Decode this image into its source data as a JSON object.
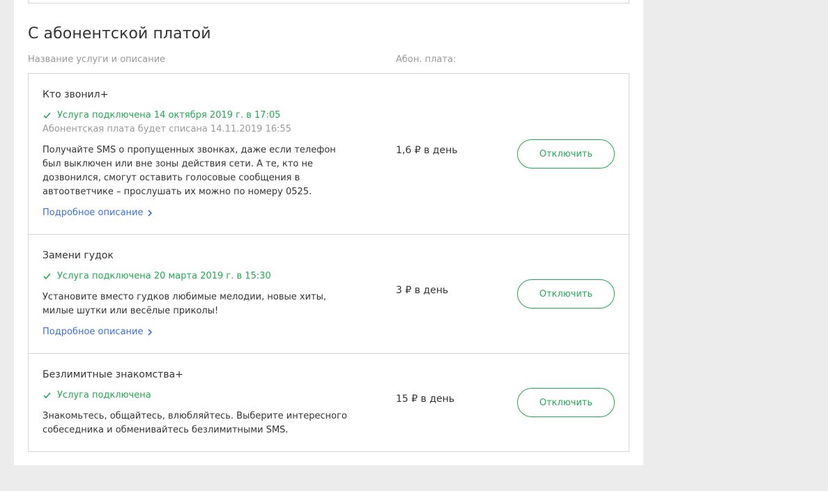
{
  "section": {
    "title": "С абонентской платой",
    "col_name": "Название услуги и описание",
    "col_fee": "Абон. плата:"
  },
  "services": [
    {
      "name": "Кто звонил+",
      "status": "Услуга подключена 14 октября 2019 г. в 17:05",
      "charge_note": "Абонентская плата будет списана 14.11.2019 16:55",
      "description": "Получайте SMS о пропущенных звонках, даже если телефон был выключен или вне зоны действия сети. А те, кто не дозвонился, смогут оставить голосовые сообщения в автоответчике – прослушать их можно по номеру 0525.",
      "more_link": "Подробное описание",
      "fee": "1,6 ₽ в день",
      "button": "Отключить"
    },
    {
      "name": "Замени гудок",
      "status": "Услуга подключена 20 марта 2019 г. в 15:30",
      "description": "Установите вместо гудков любимые мелодии, новые хиты, милые шутки или весёлые приколы!",
      "more_link": "Подробное описание",
      "fee": "3 ₽ в день",
      "button": "Отключить"
    },
    {
      "name": "Безлимитные знакомства+",
      "status": "Услуга подключена",
      "description": "Знакомьтесь, общайтесь, влюбляйтесь. Выберите интересного собеседника и обменивайтесь безлимитными SMS.",
      "fee": "15 ₽ в день",
      "button": "Отключить"
    }
  ],
  "colors": {
    "accent_green": "#22a852",
    "link_blue": "#3e6fd8",
    "muted_gray": "#999999",
    "border": "#d6d6d6",
    "background": "#ececec"
  },
  "icons": {
    "status": "check-icon",
    "link": "chevron-right-icon"
  }
}
